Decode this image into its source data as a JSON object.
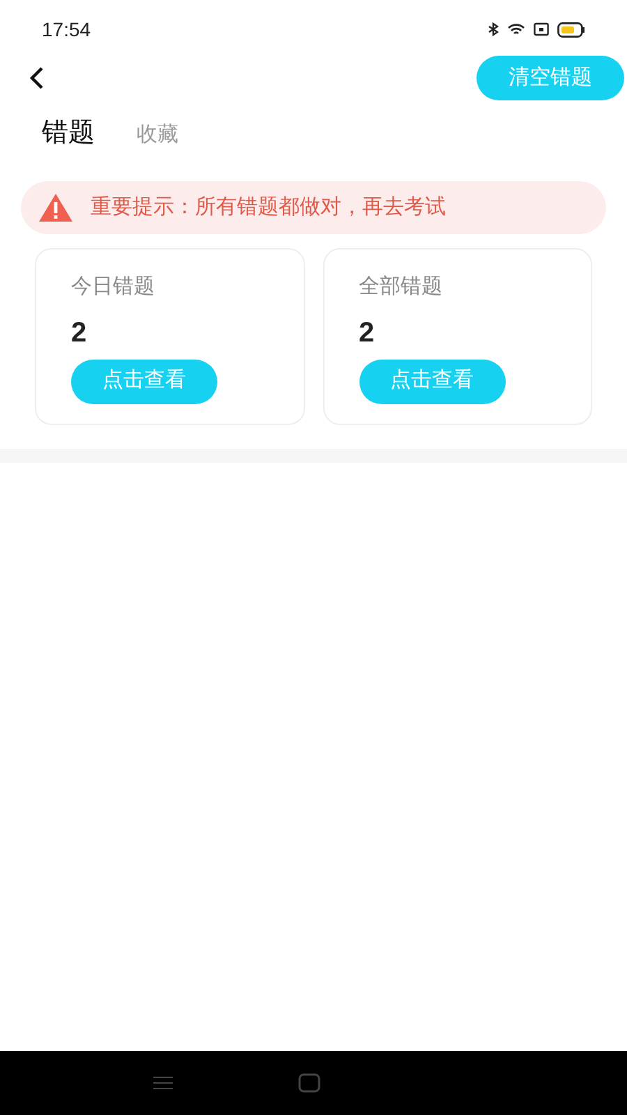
{
  "status_bar": {
    "time": "17:54"
  },
  "header": {
    "clear_button": "清空错题"
  },
  "tabs": [
    {
      "label": "错题",
      "selected": true
    },
    {
      "label": "收藏",
      "selected": false
    }
  ],
  "notice": "重要提示：所有错题都做对，再去考试",
  "cards": [
    {
      "title": "今日错题",
      "count": "2",
      "button": "点击查看"
    },
    {
      "title": "全部错题",
      "count": "2",
      "button": "点击查看"
    }
  ]
}
